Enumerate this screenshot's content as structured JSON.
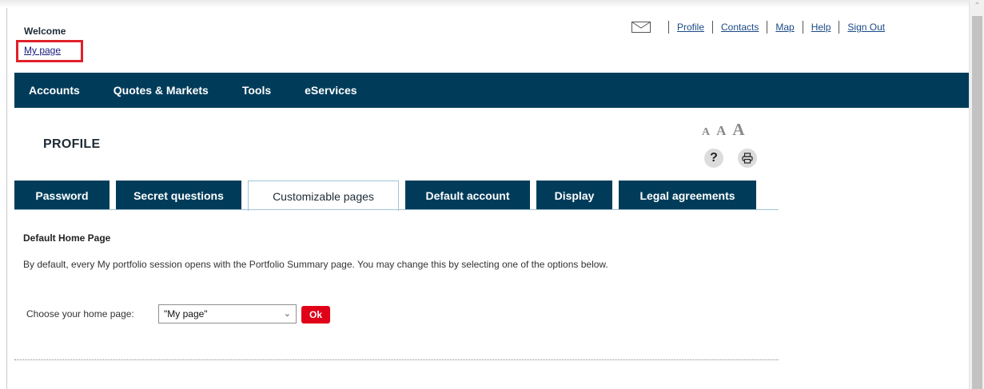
{
  "header": {
    "welcome": "Welcome",
    "my_page_link": "My page",
    "top_links": [
      "Profile",
      "Contacts",
      "Map",
      "Help",
      "Sign Out"
    ]
  },
  "nav": {
    "items": [
      "Accounts",
      "Quotes & Markets",
      "Tools",
      "eServices"
    ]
  },
  "profile": {
    "title": "PROFILE",
    "font_size_letters": [
      "A",
      "A",
      "A"
    ],
    "help_symbol": "?",
    "print_symbol": "⎙"
  },
  "tabs": [
    {
      "label": "Password",
      "active": false
    },
    {
      "label": "Secret questions",
      "active": false
    },
    {
      "label": "Customizable pages",
      "active": true
    },
    {
      "label": "Default account",
      "active": false
    },
    {
      "label": "Display",
      "active": false
    },
    {
      "label": "Legal agreements",
      "active": false
    }
  ],
  "content": {
    "section_title": "Default Home Page",
    "description": "By default, every My portfolio session opens with the Portfolio Summary page. You may change this by selecting one of the options below.",
    "choose_label": "Choose your home page:",
    "selected_option": "\"My page\"",
    "ok_label": "Ok"
  },
  "colors": {
    "navy": "#003c5a",
    "highlight_box": "#e0202b",
    "ok_button": "#e00018"
  },
  "icons": [
    "envelope-icon",
    "help-icon",
    "print-icon",
    "chevron-down-icon",
    "scroll-up-icon"
  ]
}
